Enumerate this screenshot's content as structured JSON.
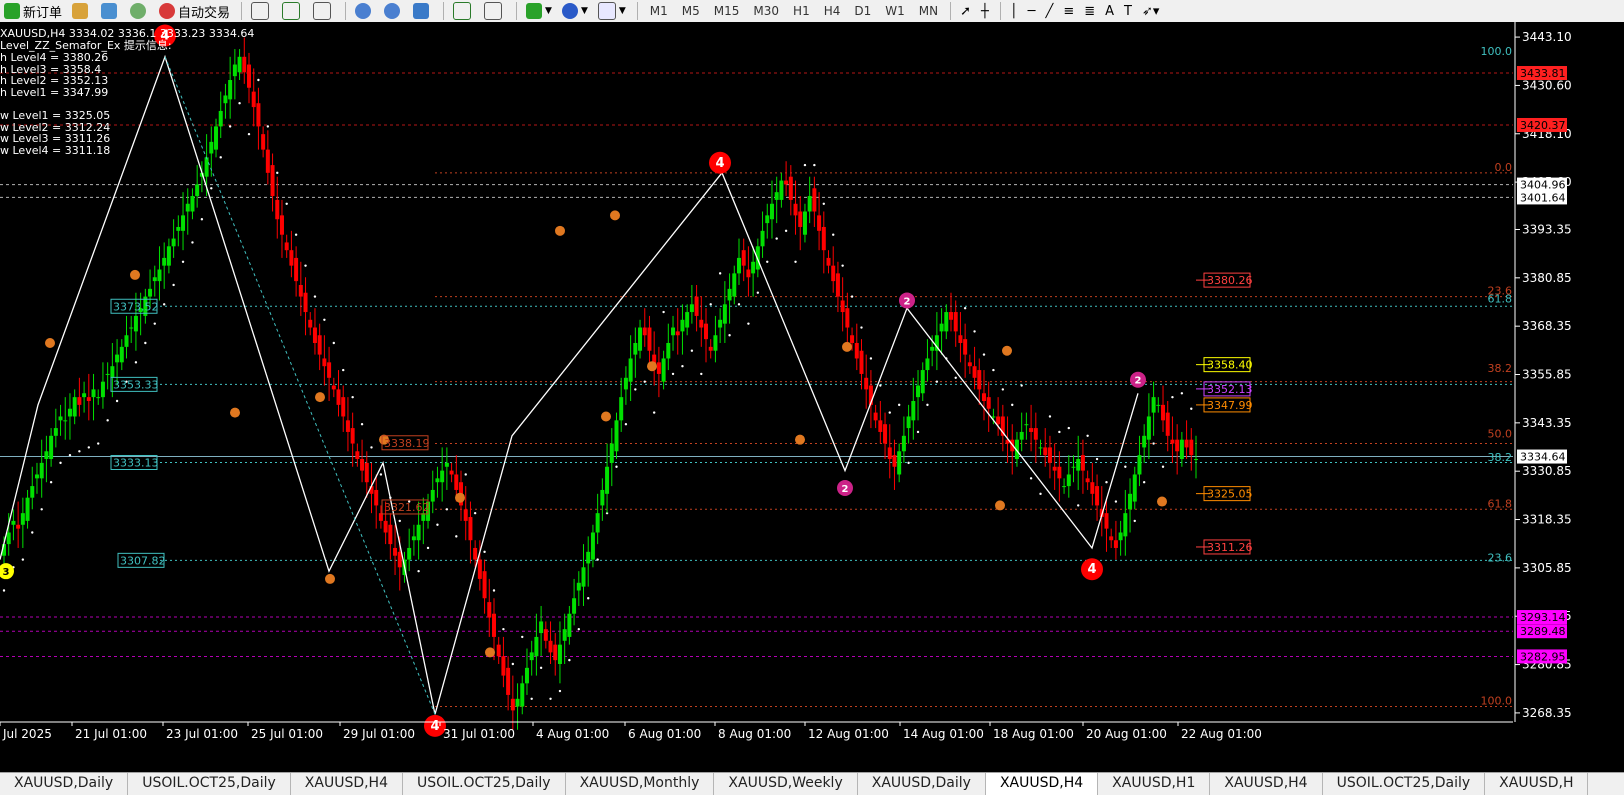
{
  "toolbar": {
    "new_order_label": "新订单",
    "auto_trade_label": "自动交易",
    "timeframes": [
      "M1",
      "M5",
      "M15",
      "M30",
      "H1",
      "H4",
      "D1",
      "W1",
      "MN"
    ]
  },
  "info": {
    "ohlc_line": "XAUUSD,H4  3334.02 3336.1  3333.23 3334.64",
    "indicator_title": "Level_ZZ_Semafor_Ex 提示信息:",
    "levels": [
      "h Level4 = 3380.26",
      "h Level3 = 3358.4",
      "h Level2 = 3352.13",
      "h Level1 = 3347.99",
      "w Level1 = 3325.05",
      "w Level2 = 3312.24",
      "w Level3 = 3311.26",
      "w Level4 = 3311.18"
    ]
  },
  "price_axis": {
    "ticks": [
      "3443.10",
      "3430.60",
      "3418.10",
      "3405.60",
      "3393.35",
      "3380.85",
      "3368.35",
      "3355.85",
      "3343.35",
      "3330.85",
      "3318.35",
      "3305.85",
      "3293.35",
      "3280.85",
      "3268.35"
    ],
    "badges": [
      {
        "label": "3433.81",
        "value": 3433.81,
        "color": "#ff2020"
      },
      {
        "label": "3420.37",
        "value": 3420.37,
        "color": "#ff2020"
      },
      {
        "label": "3404.96",
        "value": 3404.96,
        "color": "#ffffff"
      },
      {
        "label": "3401.64",
        "value": 3401.64,
        "color": "#ffffff"
      },
      {
        "label": "3334.64",
        "value": 3334.64,
        "color": "#ffffff"
      },
      {
        "label": "3293.14",
        "value": 3293.14,
        "color": "#ff00ff"
      },
      {
        "label": "3289.48",
        "value": 3289.48,
        "color": "#ff00ff"
      },
      {
        "label": "3282.95",
        "value": 3282.95,
        "color": "#ff00ff"
      }
    ]
  },
  "time_axis": [
    "Jul 2025",
    "21 Jul 01:00",
    "23 Jul 01:00",
    "25 Jul 01:00",
    "29 Jul 01:00",
    "31 Jul 01:00",
    "4 Aug 01:00",
    "6 Aug 01:00",
    "8 Aug 01:00",
    "12 Aug 01:00",
    "14 Aug 01:00",
    "18 Aug 01:00",
    "20 Aug 01:00",
    "22 Aug 01:00"
  ],
  "fib_left": [
    "3373.52",
    "3353.33",
    "3333.13",
    "3307.82",
    "3338.19",
    "3321.62"
  ],
  "fib_right_pct": [
    "100.0",
    "0.0",
    "23.6",
    "61.8",
    "38.2",
    "50.0",
    "38.2",
    "61.8",
    "23.6",
    "100.0"
  ],
  "level_labels": [
    {
      "text": "3380.26",
      "value": 3380.26,
      "color": "#ff4040"
    },
    {
      "text": "3358.40",
      "value": 3358.4,
      "color": "#ffff00"
    },
    {
      "text": "3352.13",
      "value": 3352.13,
      "color": "#cc44ff"
    },
    {
      "text": "3347.99",
      "value": 3347.99,
      "color": "#ff8c00"
    },
    {
      "text": "3325.05",
      "value": 3325.05,
      "color": "#ff8c00"
    },
    {
      "text": "3311.26",
      "value": 3311.26,
      "color": "#ff4040"
    }
  ],
  "markers": [
    {
      "label": "4",
      "value": 3443.5,
      "x": 165,
      "color": "#ff0000"
    },
    {
      "label": "4",
      "value": 3410.6,
      "x": 720,
      "color": "#ff0000"
    },
    {
      "label": "4",
      "value": 3305.5,
      "x": 1092,
      "color": "#ff0000"
    },
    {
      "label": "4",
      "value": 3265.0,
      "x": 435,
      "color": "#ff0000"
    },
    {
      "label": "3",
      "value": 3305.0,
      "x": 6,
      "color": "#ffff00"
    },
    {
      "label": "2",
      "value": 3375.0,
      "x": 907,
      "color": "#cc2288"
    },
    {
      "label": "2",
      "value": 3326.5,
      "x": 845,
      "color": "#cc2288"
    },
    {
      "label": "2",
      "value": 3354.5,
      "x": 1138,
      "color": "#cc2288"
    }
  ],
  "tabs": [
    "XAUUSD,Daily",
    "USOIL.OCT25,Daily",
    "XAUUSD,H4",
    "USOIL.OCT25,Daily",
    "XAUUSD,Monthly",
    "XAUUSD,Weekly",
    "XAUUSD,Daily",
    "XAUUSD,H4",
    "XAUUSD,H1",
    "XAUUSD,H4",
    "USOIL.OCT25,Daily",
    "XAUUSD,H"
  ],
  "active_tab_index": 7,
  "chart_data": {
    "type": "candlestick",
    "symbol": "XAUUSD",
    "timeframe": "H4",
    "ylim": [
      3266,
      3447
    ],
    "zigzag": [
      [
        0,
        3308
      ],
      [
        38,
        3348
      ],
      [
        165,
        3438
      ],
      [
        329,
        3305
      ],
      [
        383,
        3333
      ],
      [
        435,
        3268
      ],
      [
        512,
        3340
      ],
      [
        722,
        3408
      ],
      [
        845,
        3331
      ],
      [
        907,
        3373
      ],
      [
        1092,
        3311
      ],
      [
        1138,
        3351
      ]
    ],
    "closes": [
      3312,
      3315,
      3318,
      3316,
      3320,
      3324,
      3327,
      3330,
      3333,
      3336,
      3340,
      3342,
      3345,
      3344,
      3347,
      3350,
      3348,
      3351,
      3349,
      3352,
      3350,
      3354,
      3356,
      3358,
      3361,
      3363,
      3366,
      3368,
      3371,
      3373,
      3376,
      3378,
      3381,
      3383,
      3386,
      3389,
      3391,
      3394,
      3397,
      3400,
      3402,
      3405,
      3408,
      3412,
      3416,
      3420,
      3424,
      3428,
      3432,
      3436,
      3438,
      3434,
      3430,
      3425,
      3420,
      3414,
      3408,
      3402,
      3396,
      3392,
      3388,
      3384,
      3380,
      3376,
      3372,
      3368,
      3364,
      3361,
      3358,
      3355,
      3352,
      3348,
      3345,
      3341,
      3338,
      3334,
      3331,
      3328,
      3325,
      3322,
      3318,
      3315,
      3312,
      3309,
      3306,
      3308,
      3311,
      3314,
      3317,
      3320,
      3323,
      3326,
      3329,
      3331,
      3333,
      3330,
      3326,
      3322,
      3318,
      3313,
      3308,
      3303,
      3298,
      3293,
      3288,
      3283,
      3278,
      3273,
      3269,
      3272,
      3276,
      3280,
      3284,
      3288,
      3292,
      3287,
      3284,
      3282,
      3286,
      3290,
      3294,
      3298,
      3302,
      3306,
      3310,
      3315,
      3320,
      3326,
      3332,
      3338,
      3344,
      3350,
      3355,
      3360,
      3364,
      3368,
      3366,
      3362,
      3358,
      3356,
      3360,
      3364,
      3368,
      3366,
      3370,
      3372,
      3374,
      3371,
      3368,
      3365,
      3362,
      3366,
      3370,
      3374,
      3378,
      3382,
      3386,
      3384,
      3381,
      3385,
      3389,
      3393,
      3397,
      3400,
      3403,
      3406,
      3405,
      3401,
      3397,
      3394,
      3398,
      3402,
      3398,
      3393,
      3388,
      3384,
      3380,
      3376,
      3372,
      3368,
      3364,
      3360,
      3356,
      3352,
      3348,
      3344,
      3341,
      3338,
      3334,
      3332,
      3336,
      3340,
      3345,
      3349,
      3353,
      3357,
      3360,
      3363,
      3366,
      3369,
      3372,
      3370,
      3367,
      3364,
      3361,
      3358,
      3355,
      3352,
      3349,
      3347,
      3345,
      3343,
      3340,
      3338,
      3336,
      3339,
      3341,
      3343,
      3341,
      3339,
      3337,
      3335,
      3333,
      3331,
      3329,
      3327,
      3330,
      3332,
      3334,
      3331,
      3328,
      3325,
      3322,
      3319,
      3316,
      3313,
      3311,
      3315,
      3320,
      3325,
      3330,
      3335,
      3340,
      3345,
      3350,
      3348,
      3344,
      3340,
      3338,
      3336,
      3339,
      3337,
      3335,
      3334
    ]
  }
}
